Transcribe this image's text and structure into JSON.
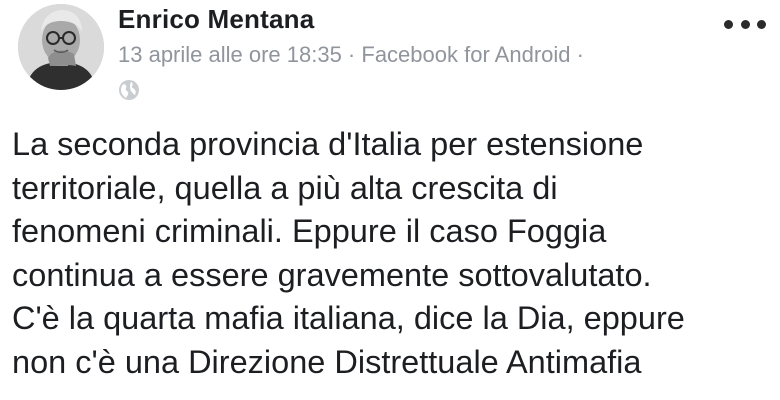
{
  "post": {
    "author": "Enrico Mentana",
    "timestamp": "13 aprile alle ore 18:35 · Facebook for Android ·",
    "privacy_icon": "globe-icon",
    "menu_icon": "more-options-icon",
    "text_lines": [
      "La seconda provincia d'Italia per estensione",
      "territoriale, quella a più alta crescita di",
      "fenomeni criminali. Eppure il caso Foggia",
      "continua a essere gravemente sottovalutato.",
      "C'è la quarta mafia italiana, dice la Dia, eppure",
      "non c'è una Direzione Distrettuale Antimafia"
    ]
  }
}
